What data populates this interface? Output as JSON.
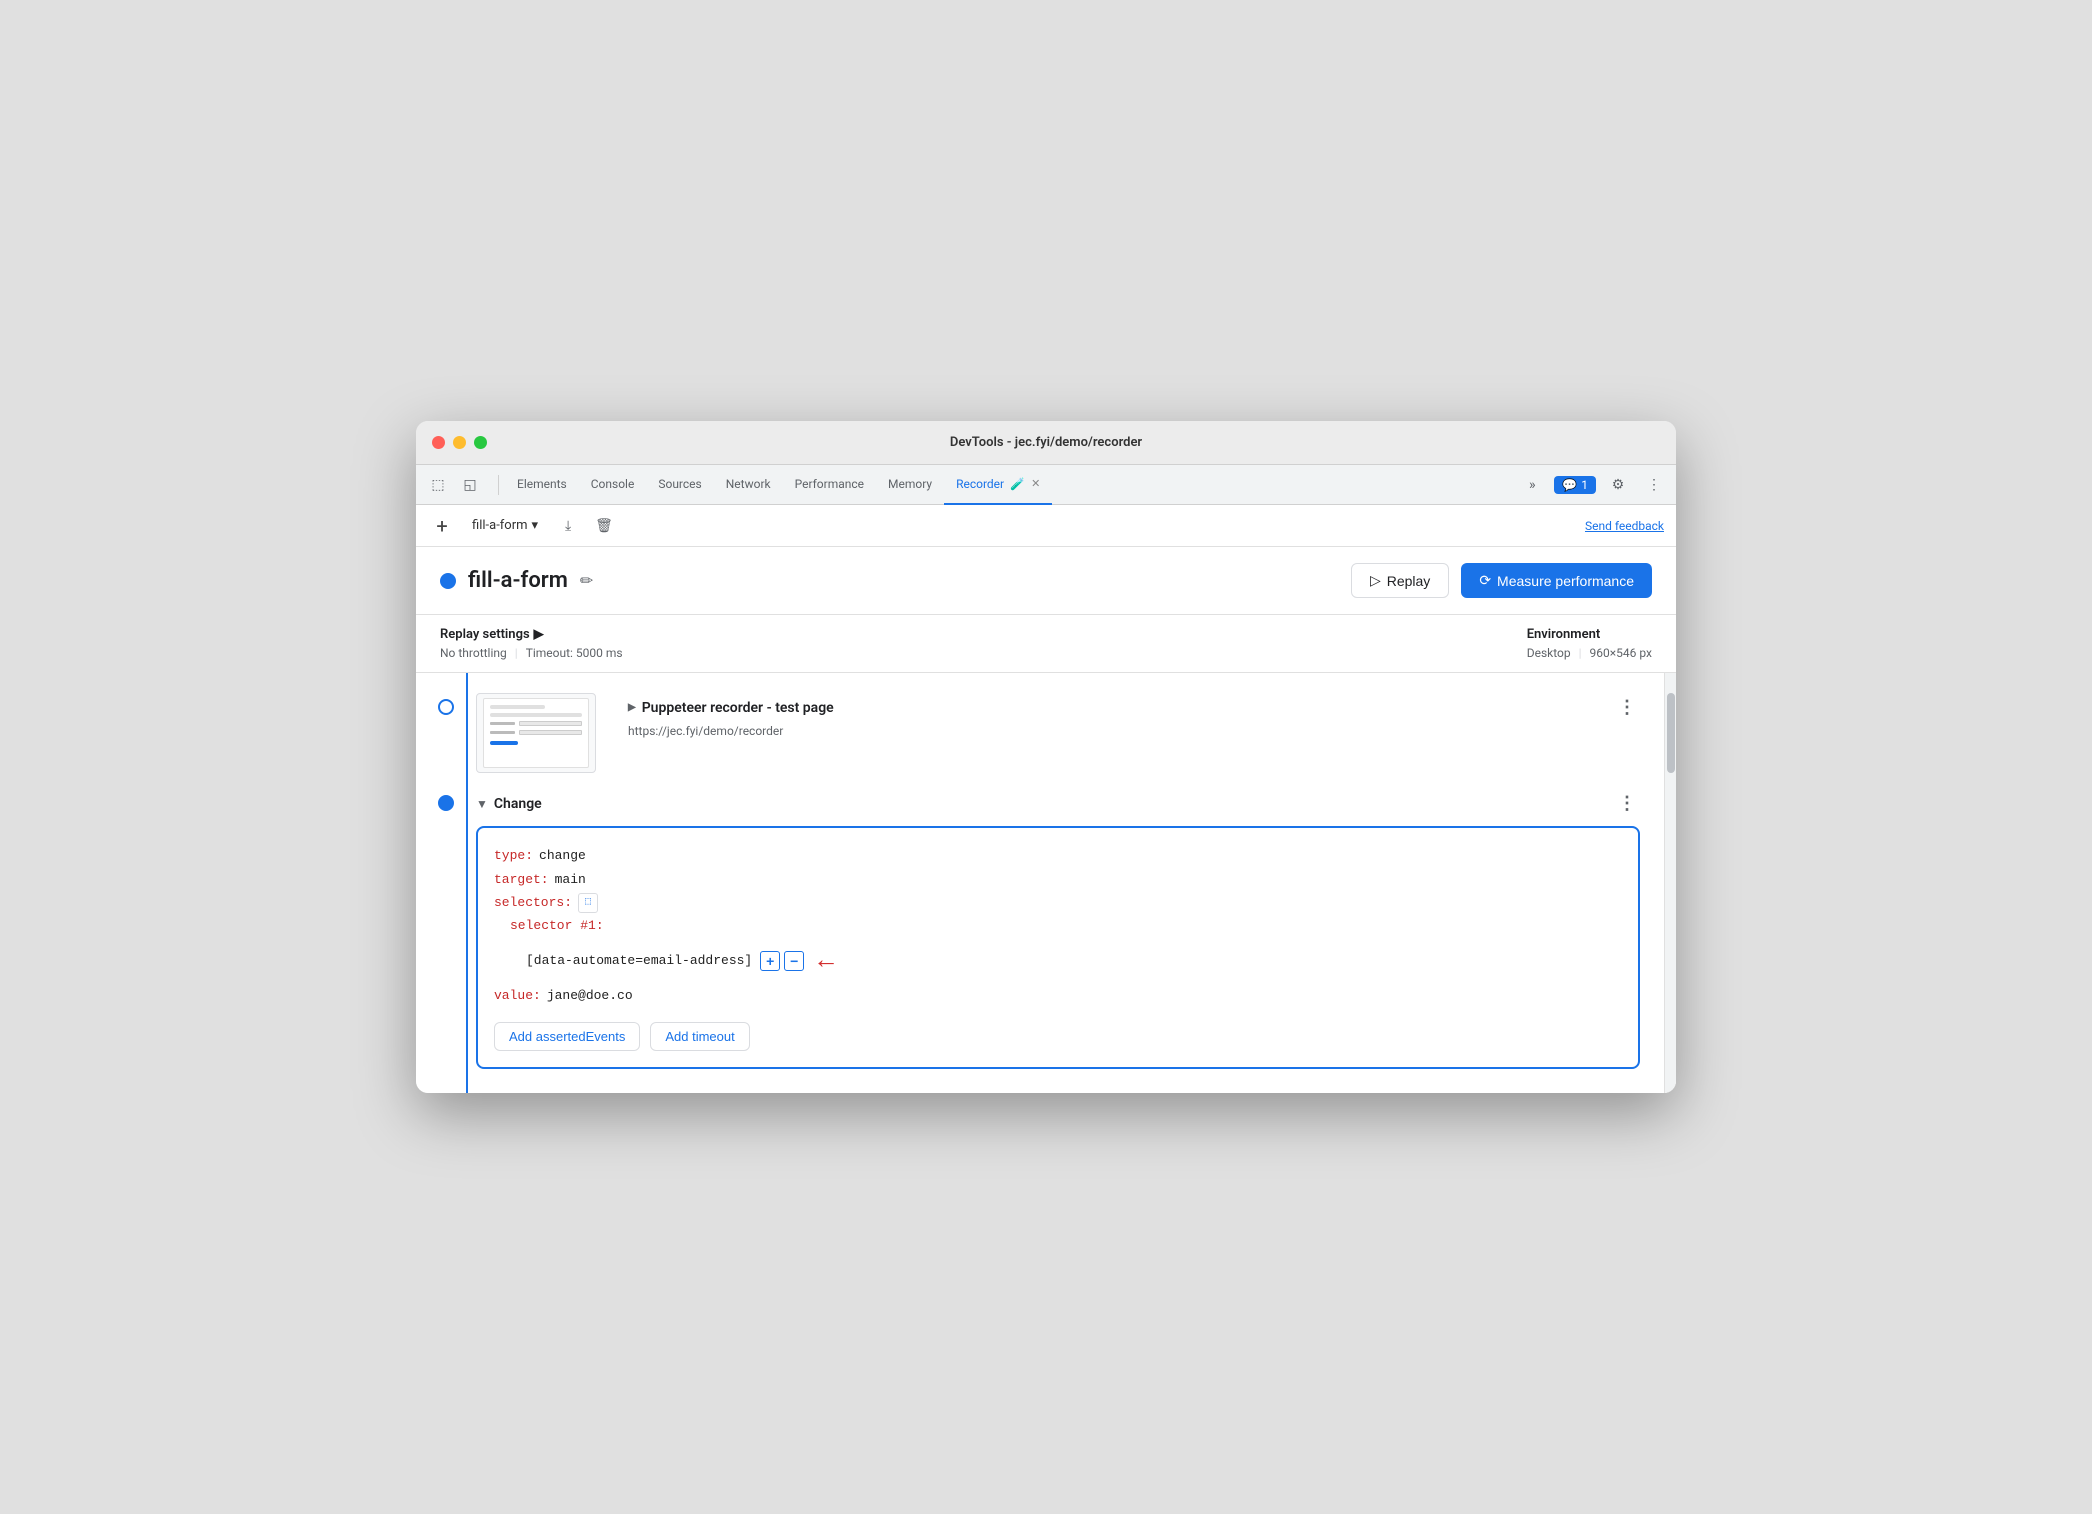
{
  "window": {
    "title": "DevTools - jec.fyi/demo/recorder"
  },
  "tabs": {
    "elements": "Elements",
    "console": "Console",
    "sources": "Sources",
    "network": "Network",
    "performance": "Performance",
    "memory": "Memory",
    "recorder": "Recorder",
    "more": "»",
    "chat_badge": "1"
  },
  "toolbar": {
    "recording_name": "fill-a-form",
    "send_feedback": "Send feedback"
  },
  "recording": {
    "dot_color": "#1a73e8",
    "name": "fill-a-form",
    "replay_label": "Replay",
    "measure_label": "Measure performance"
  },
  "settings": {
    "replay_settings_label": "Replay settings",
    "throttling": "No throttling",
    "timeout": "Timeout: 5000 ms",
    "environment_label": "Environment",
    "env_type": "Desktop",
    "env_size": "960×546 px"
  },
  "steps": {
    "step1": {
      "title": "Puppeteer recorder - test page",
      "url": "https://jec.fyi/demo/recorder"
    },
    "step2": {
      "title": "Change",
      "type_key": "type:",
      "type_val": "change",
      "target_key": "target:",
      "target_val": "main",
      "selectors_key": "selectors:",
      "selector_num_key": "selector #1:",
      "selector_val": "[data-automate=email-address]",
      "value_key": "value:",
      "value_val": "jane@doe.co",
      "btn_asserted": "Add assertedEvents",
      "btn_timeout": "Add timeout"
    }
  }
}
